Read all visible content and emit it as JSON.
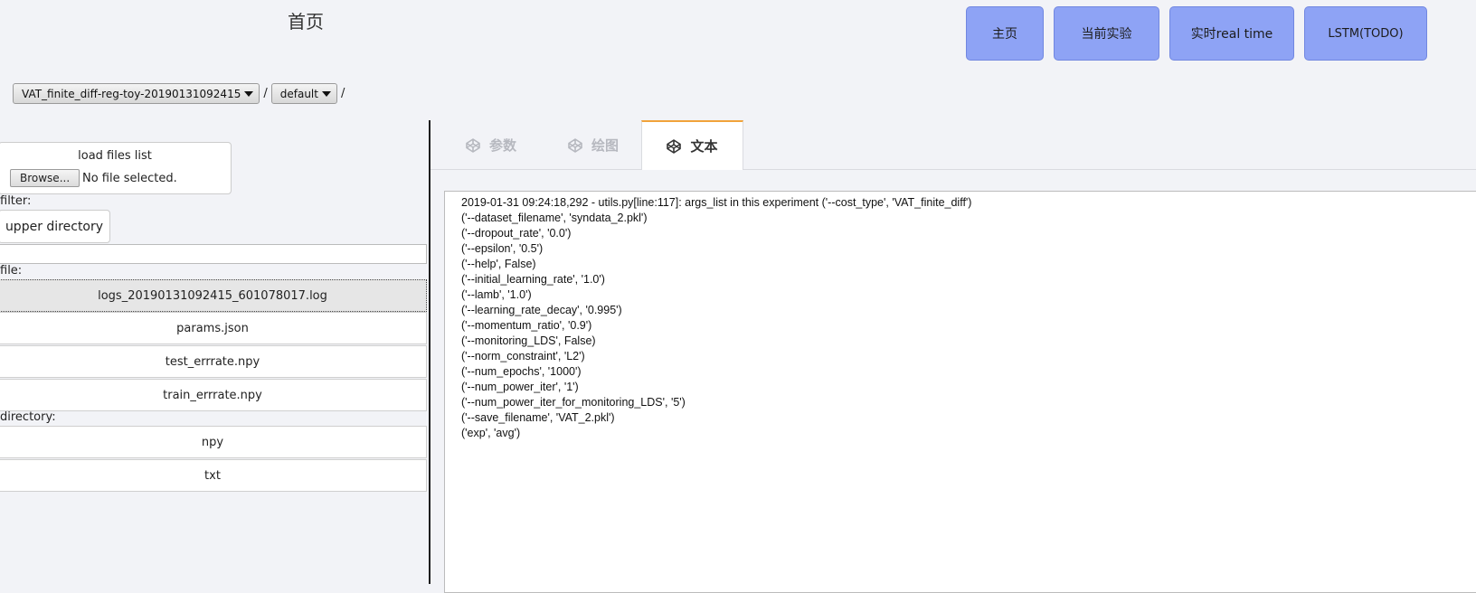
{
  "header": {
    "title": "首页"
  },
  "nav": {
    "items": [
      "主页",
      "当前实验",
      "实时real time",
      "LSTM(TODO)"
    ]
  },
  "breadcrumb": {
    "experiment": "VAT_finite_diff-reg-toy-20190131092415",
    "sep": "/",
    "run": "default"
  },
  "load": {
    "title": "load files list",
    "browse_label": "Browse...",
    "no_file_text": "No file selected."
  },
  "filter": {
    "label": "filter:",
    "updir_label": "upper directory",
    "value": ""
  },
  "files": {
    "label": "file:",
    "items": [
      "logs_20190131092415_601078017.log",
      "params.json",
      "test_errrate.npy",
      "train_errrate.npy"
    ],
    "selected": "logs_20190131092415_601078017.log"
  },
  "directories": {
    "label": "directory:",
    "items": [
      "npy",
      "txt"
    ]
  },
  "tabs": {
    "items": [
      "参数",
      "绘图",
      "文本"
    ],
    "active": "文本"
  },
  "text_panel": {
    "lines": [
      "2019-01-31 09:24:18,292 - utils.py[line:117]: args_list in this experiment ('--cost_type', 'VAT_finite_diff')",
      "('--dataset_filename', 'syndata_2.pkl')",
      "('--dropout_rate', '0.0')",
      "('--epsilon', '0.5')",
      "('--help', False)",
      "('--initial_learning_rate', '1.0')",
      "('--lamb', '1.0')",
      "('--learning_rate_decay', '0.995')",
      "('--momentum_ratio', '0.9')",
      "('--monitoring_LDS', False)",
      "('--norm_constraint', 'L2')",
      "('--num_epochs', '1000')",
      "('--num_power_iter', '1')",
      "('--num_power_iter_for_monitoring_LDS', '5')",
      "('--save_filename', 'VAT_2.pkl')",
      "('exp', 'avg')"
    ]
  },
  "colors": {
    "nav_button": "#8ea3f5",
    "tab_active_border": "#f1a33a",
    "page_bg": "#f2f3f7"
  }
}
